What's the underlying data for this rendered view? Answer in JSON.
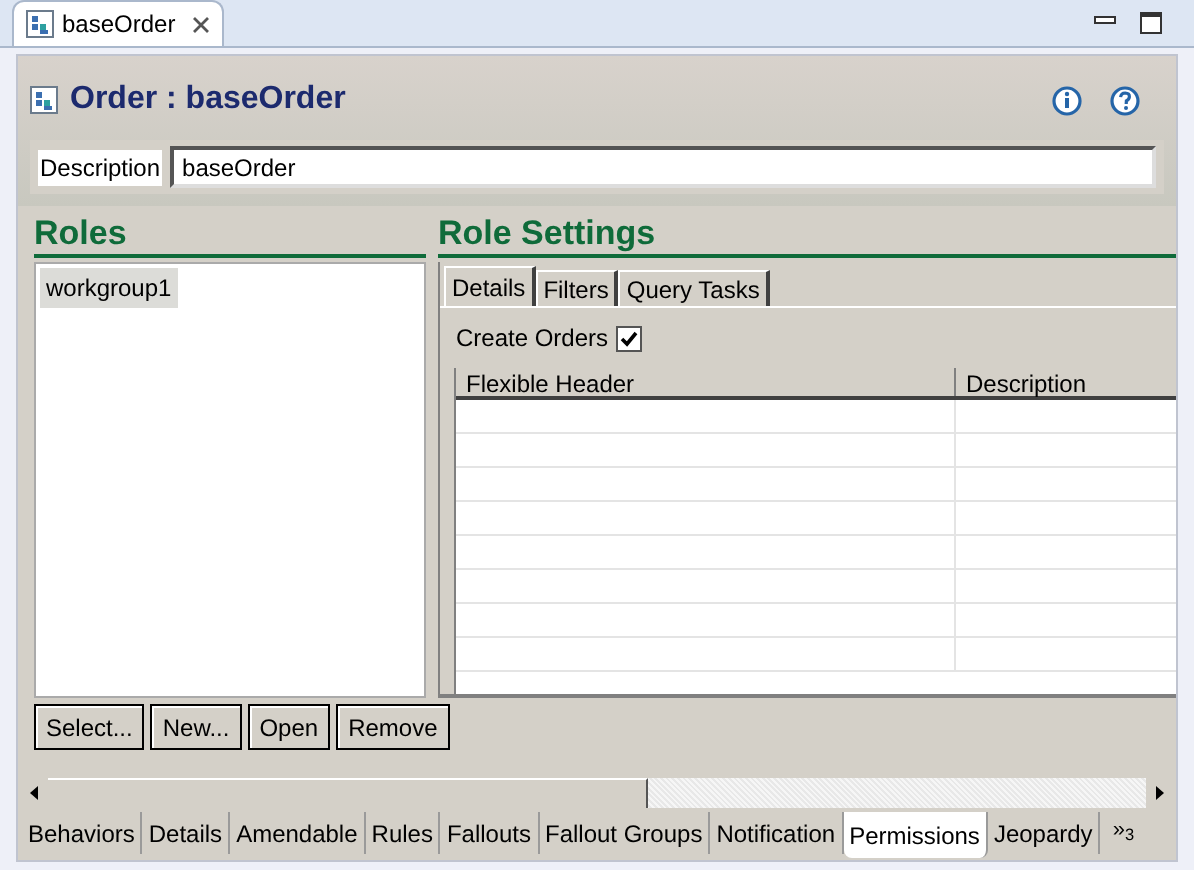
{
  "editor_tab": {
    "title": "baseOrder"
  },
  "form": {
    "title": "Order : baseOrder",
    "description_label": "Description",
    "description_value": "baseOrder"
  },
  "roles": {
    "heading": "Roles",
    "items": [
      {
        "label": "workgroup1",
        "selected": true
      }
    ],
    "buttons": [
      "Select...",
      "New...",
      "Open",
      "Remove"
    ]
  },
  "role_settings": {
    "heading": "Role Settings",
    "tabs": [
      {
        "label": "Details",
        "selected": true
      },
      {
        "label": "Filters",
        "selected": false
      },
      {
        "label": "Query Tasks",
        "selected": false
      }
    ],
    "create_orders": {
      "label": "Create Orders",
      "checked": true
    },
    "table": {
      "columns": [
        "Flexible Header",
        "Description"
      ]
    }
  },
  "bottom_tabs": [
    {
      "label": "Behaviors",
      "selected": false
    },
    {
      "label": "Details",
      "selected": false
    },
    {
      "label": "Amendable",
      "selected": false
    },
    {
      "label": "Rules",
      "selected": false
    },
    {
      "label": "Fallouts",
      "selected": false
    },
    {
      "label": "Fallout Groups",
      "selected": false
    },
    {
      "label": "Notification",
      "selected": false
    },
    {
      "label": "Permissions",
      "selected": true
    },
    {
      "label": "Jeopardy",
      "selected": false
    }
  ],
  "overflow": "»$_{3}$"
}
